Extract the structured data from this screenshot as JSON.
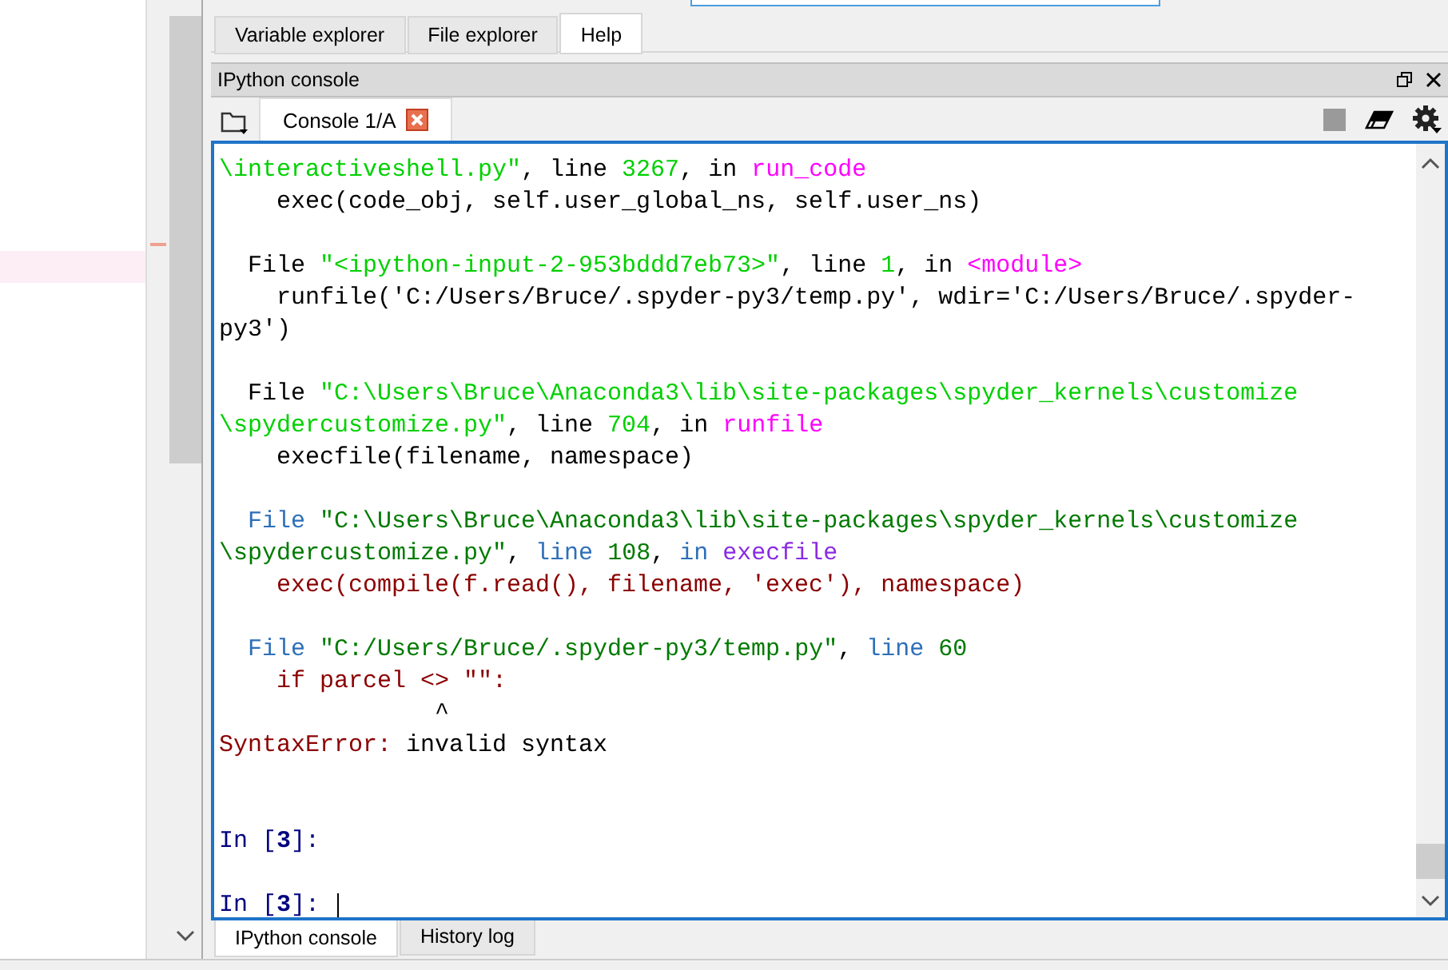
{
  "top_tabs": [
    {
      "label": "Variable explorer",
      "selected": false
    },
    {
      "label": "File explorer",
      "selected": false
    },
    {
      "label": "Help",
      "selected": true
    }
  ],
  "dock": {
    "title": "IPython console"
  },
  "console_tabs": [
    {
      "label": "Console 1/A",
      "selected": true
    }
  ],
  "console_blocks": [
    {
      "kind": "output",
      "lines": [
        [
          {
            "kind": "green",
            "text": "\\interactiveshell.py\""
          },
          {
            "kind": "plain",
            "text": ", line "
          },
          {
            "kind": "green",
            "text": "3267"
          },
          {
            "kind": "plain",
            "text": ", in "
          },
          {
            "kind": "magenta",
            "text": "run_code"
          }
        ],
        [
          {
            "kind": "plain",
            "text": "    exec(code_obj, self.user_global_ns, self.user_ns)"
          }
        ]
      ]
    },
    {
      "kind": "output",
      "lines": [
        [
          {
            "kind": "plain",
            "text": "  File "
          },
          {
            "kind": "green",
            "text": "\"<ipython-input-2-953bddd7eb73>\""
          },
          {
            "kind": "plain",
            "text": ", line "
          },
          {
            "kind": "green",
            "text": "1"
          },
          {
            "kind": "plain",
            "text": ", in "
          },
          {
            "kind": "magenta",
            "text": "<module>"
          }
        ],
        [
          {
            "kind": "plain",
            "text": "    runfile('C:/Users/Bruce/.spyder-py3/temp.py', wdir='C:/Users/Bruce/.spyder-"
          }
        ],
        [
          {
            "kind": "plain",
            "text": "py3')"
          }
        ]
      ]
    },
    {
      "kind": "output",
      "lines": [
        [
          {
            "kind": "plain",
            "text": "  File "
          },
          {
            "kind": "green",
            "text": "\"C:\\Users\\Bruce\\Anaconda3\\lib\\site-packages\\spyder_kernels\\customize"
          }
        ],
        [
          {
            "kind": "green",
            "text": "\\spydercustomize.py\""
          },
          {
            "kind": "plain",
            "text": ", line "
          },
          {
            "kind": "green",
            "text": "704"
          },
          {
            "kind": "plain",
            "text": ", in "
          },
          {
            "kind": "magenta",
            "text": "runfile"
          }
        ],
        [
          {
            "kind": "plain",
            "text": "    execfile(filename, namespace)"
          }
        ]
      ]
    },
    {
      "kind": "output",
      "lines": [
        [
          {
            "kind": "blue",
            "text": "  File "
          },
          {
            "kind": "darkgreen",
            "text": "\"C:\\Users\\Bruce\\Anaconda3\\lib\\site-packages\\spyder_kernels\\customize"
          }
        ],
        [
          {
            "kind": "darkgreen",
            "text": "\\spydercustomize.py\""
          },
          {
            "kind": "plain",
            "text": ", "
          },
          {
            "kind": "blue",
            "text": "line "
          },
          {
            "kind": "darkgreen",
            "text": "108"
          },
          {
            "kind": "plain",
            "text": ", "
          },
          {
            "kind": "blue",
            "text": "in "
          },
          {
            "kind": "purple",
            "text": "execfile"
          }
        ],
        [
          {
            "kind": "darkred",
            "text": "    exec(compile(f.read(), filename, 'exec'), namespace)"
          }
        ]
      ]
    },
    {
      "kind": "output",
      "lines": [
        [
          {
            "kind": "blue",
            "text": "  File "
          },
          {
            "kind": "darkgreen",
            "text": "\"C:/Users/Bruce/.spyder-py3/temp.py\""
          },
          {
            "kind": "plain",
            "text": ", "
          },
          {
            "kind": "blue",
            "text": "line "
          },
          {
            "kind": "darkgreen",
            "text": "60"
          }
        ],
        [
          {
            "kind": "darkred",
            "text": "    if parcel <> \"\":"
          }
        ],
        [
          {
            "kind": "plain",
            "text": "               ^"
          }
        ],
        [
          {
            "kind": "darkred",
            "text": "SyntaxError:"
          },
          {
            "kind": "plain",
            "text": " invalid syntax"
          }
        ]
      ]
    },
    {
      "kind": "input",
      "cursor": false,
      "lines": [
        [
          {
            "kind": "navy",
            "text": "In ["
          },
          {
            "kind": "navybold",
            "text": "3"
          },
          {
            "kind": "navy",
            "text": "]:"
          }
        ]
      ]
    },
    {
      "kind": "input",
      "cursor": true,
      "lines": [
        [
          {
            "kind": "navy",
            "text": "In ["
          },
          {
            "kind": "navybold",
            "text": "3"
          },
          {
            "kind": "navy",
            "text": "]: "
          }
        ]
      ]
    }
  ],
  "bottom_tabs": [
    {
      "label": "IPython console",
      "selected": true
    },
    {
      "label": "History log",
      "selected": false
    }
  ]
}
